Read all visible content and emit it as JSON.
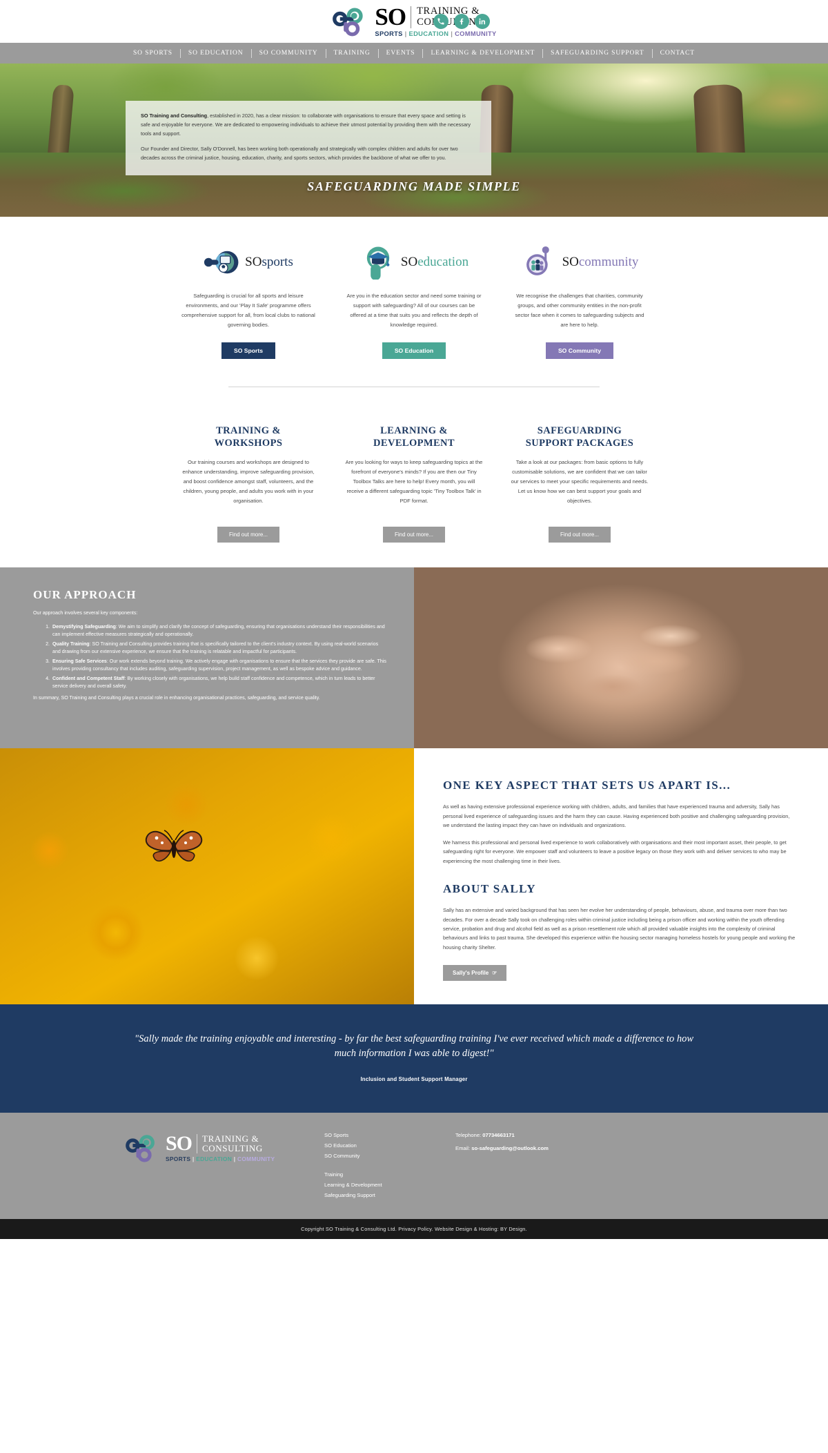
{
  "header": {
    "brand": {
      "so": "SO",
      "line1": "TRAINING &",
      "line2": "CONSULTING",
      "sub_sports": "SPORTS",
      "sub_education": "EDUCATION",
      "sub_community": "COMMUNITY",
      "sep": "|"
    },
    "social": [
      {
        "name": "phone-icon",
        "label": "Phone"
      },
      {
        "name": "facebook-icon",
        "label": "Facebook"
      },
      {
        "name": "linkedin-icon",
        "label": "LinkedIn"
      }
    ]
  },
  "nav": {
    "items": [
      "SO SPORTS",
      "SO EDUCATION",
      "SO COMMUNITY",
      "TRAINING",
      "EVENTS",
      "LEARNING & DEVELOPMENT",
      "SAFEGUARDING SUPPORT",
      "CONTACT"
    ]
  },
  "hero": {
    "p1_bold": "SO Training and Consulting",
    "p1_rest": ", established in 2020, has a clear mission: to collaborate with organisations to ensure that every space and setting is safe and enjoyable for everyone. We are dedicated to empowering individuals to achieve their utmost potential by providing them with the necessary tools and support.",
    "p2": "Our Founder and Director, Sally O'Donnell, has been working both operationally and strategically with complex children and adults for over two decades across the criminal justice, housing, education, charity, and sports sectors, which provides the backbone of what we offer to you.",
    "tagline": "SAFEGUARDING MADE SIMPLE"
  },
  "services": [
    {
      "logo_dark": "SO",
      "logo_accent": "sports",
      "text": "Safeguarding is crucial for all sports and leisure environments, and our 'Play It Safe' programme offers comprehensive support for all, from local clubs to national governing bodies.",
      "button": "SO Sports",
      "color": "#1f3b63"
    },
    {
      "logo_dark": "SO",
      "logo_accent": "education",
      "text": "Are you in the education sector and need some training or support with safeguarding? All of our courses can be offered at a time that suits you and reflects the depth of knowledge required.",
      "button": "SO Education",
      "color": "#4aa795"
    },
    {
      "logo_dark": "SO",
      "logo_accent": "community",
      "text": "We recognise the challenges that charities, community groups, and other community entities in the non-profit sector face when it comes to safeguarding subjects and are here to help.",
      "button": "SO Community",
      "color": "#8478b5"
    }
  ],
  "second_row": [
    {
      "heading_line1": "TRAINING &",
      "heading_line2": "WORKSHOPS",
      "text": "Our training courses and workshops are designed to enhance understanding, improve safeguarding provision, and boost confidence amongst staff, volunteers, and the children, young people, and adults you work with in your organisation.",
      "button": "Find out more..."
    },
    {
      "heading_line1": "LEARNING &",
      "heading_line2": "DEVELOPMENT",
      "text": "Are you looking for ways to keep safeguarding topics at the forefront of everyone's minds?  If you are then our Tiny Toolbox Talks are here to help! Every month, you will receive a different safeguarding topic 'Tiny Toolbox Talk' in PDF format.",
      "button": "Find out more..."
    },
    {
      "heading_line1": "SAFEGUARDING",
      "heading_line2": "SUPPORT PACKAGES",
      "text": "Take a look at our packages: from basic options to fully customisable solutions, we are confident that we can tailor our services to meet your specific requirements and needs. Let us know how we can best support your goals and objectives.",
      "button": "Find out more..."
    }
  ],
  "approach": {
    "title": "OUR APPROACH",
    "lead": "Our approach involves several key components:",
    "items": [
      {
        "bold": "Demystifying Safeguarding",
        "rest": ": We aim to simplify and clarify the concept of safeguarding, ensuring that organisations understand their responsibilities and can implement effective measures strategically and operationally."
      },
      {
        "bold": "Quality Training",
        "rest": ": SO Training and Consulting provides training that is specifically tailored to the client's industry context. By using real-world scenarios and drawing from our extensive experience, we ensure that the training is relatable and impactful for participants."
      },
      {
        "bold": "Ensuring Safe Services",
        "rest": ": Our work extends beyond training. We actively engage with organisations to ensure that the services they provide are safe. This involves providing consultancy that includes auditing, safeguarding supervision, project management, as well as bespoke advice and guidance."
      },
      {
        "bold": "Confident and Competent Staff",
        "rest": ": By working closely with organisations, we help build staff confidence and competence, which in turn leads to better service delivery and overall safety."
      }
    ],
    "summary": "In summary, SO Training and Consulting plays a crucial role in enhancing organisational practices, safeguarding, and service quality."
  },
  "sally": {
    "heading1": "ONE KEY ASPECT THAT SETS US APART IS...",
    "p1": "As well as having extensive professional experience working with children, adults, and families that have experienced trauma and adversity, Sally has personal lived experience of safeguarding issues and the harm they can cause. Having experienced both positive and challenging safeguarding provision, we understand the lasting impact they can have on individuals and organizations.",
    "p2": "We harness this professional and personal lived experience to work collaboratively with organisations and their most important asset, their people, to get safeguarding right for everyone. We empower staff and volunteers to leave a positive legacy on those they work with and deliver services to who may be experiencing the most challenging time in their lives.",
    "heading2": "ABOUT SALLY",
    "p3": "Sally has an extensive and varied background that has seen her evolve her understanding of people, behaviours, abuse, and trauma over more than two decades.  For over a decade Sally took on challenging roles within criminal justice including being a prison officer and working within the youth offending service, probation and drug and alcohol field as well as a prison resettlement role which all provided valuable insights into the complexity of criminal behaviours and links to past trauma. She developed this experience within the housing sector managing homeless hostels for young people and working the housing charity Shelter.",
    "button": "Sally's Profile"
  },
  "testimonial": {
    "quote": "\"Sally made the training enjoyable and interesting - by far the best safeguarding training I've ever received which made a difference to how much information I was able to digest!\"",
    "attribution": "Inclusion and Student Support Manager"
  },
  "footer": {
    "brand": {
      "so": "SO",
      "line1": "TRAINING &",
      "line2": "CONSULTING",
      "sub_sports": "SPORTS",
      "sub_education": "EDUCATION",
      "sub_community": "COMMUNITY",
      "sep": "|"
    },
    "links": [
      "SO Sports",
      "SO Education",
      "SO Community",
      "Training",
      "Learning & Development",
      "Safeguarding Support"
    ],
    "telephone_label": "Telephone:",
    "telephone_value": "07734663171",
    "email_label": "Email:",
    "email_value": "so-safeguarding@outlook.com",
    "copyright": "Copyright SO Training & Consulting Ltd. Privacy Policy. Website Design & Hosting: BY Design."
  }
}
